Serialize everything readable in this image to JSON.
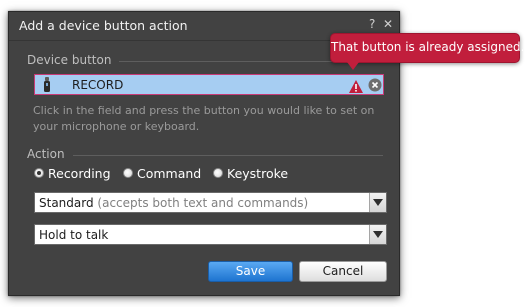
{
  "dialog": {
    "title": "Add a device button action",
    "help_glyph": "?",
    "close_glyph": "✕"
  },
  "device_button": {
    "section_label": "Device button",
    "value": "RECORD",
    "hint": "Click in the field and press the button you would like to set on your microphone or keyboard.",
    "error_tooltip": "That button is already assigned."
  },
  "action": {
    "section_label": "Action",
    "options": [
      {
        "label": "Recording",
        "checked": true
      },
      {
        "label": "Command",
        "checked": false
      },
      {
        "label": "Keystroke",
        "checked": false
      }
    ],
    "mode_select": {
      "value": "Standard",
      "note": "(accepts both text and commands)"
    },
    "trigger_select": {
      "value": "Hold to talk"
    }
  },
  "buttons": {
    "save": "Save",
    "cancel": "Cancel"
  },
  "colors": {
    "dialog_bg": "#424242",
    "field_highlight": "#a6cdf2",
    "error_red": "#c11e3c",
    "primary_blue": "#1e74d0"
  },
  "icons": [
    "microphone-icon",
    "warning-icon",
    "clear-icon",
    "dropdown-arrow-icon"
  ]
}
